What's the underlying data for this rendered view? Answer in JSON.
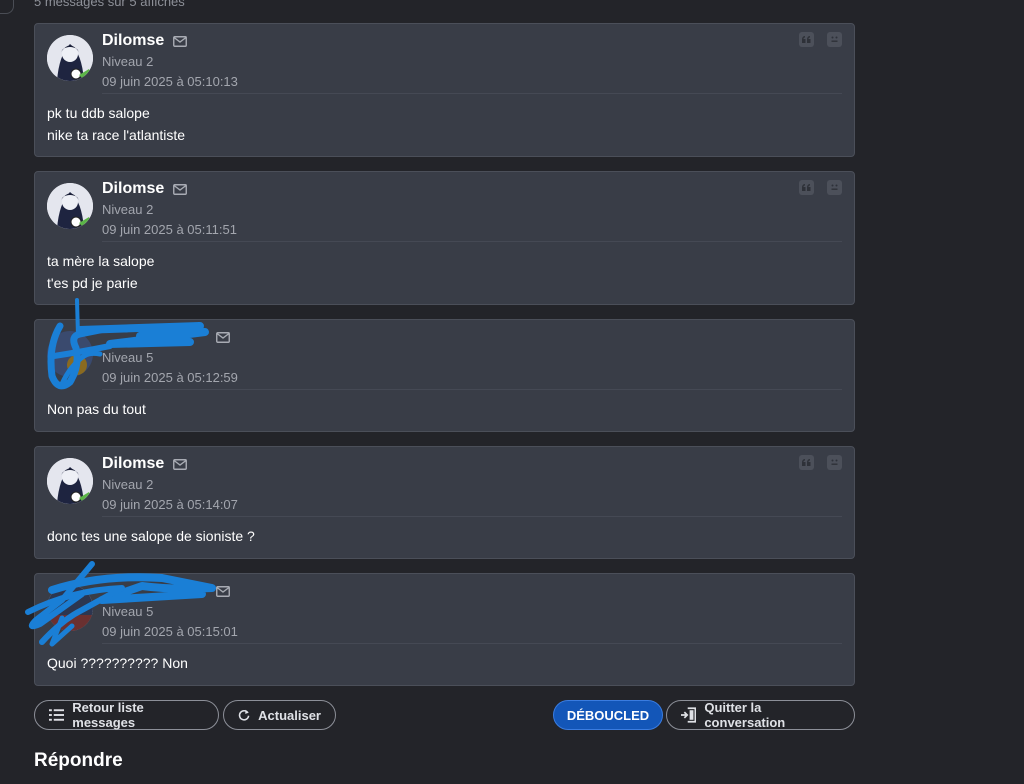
{
  "header": {
    "count_text": "5 messages sur 5 affichés"
  },
  "messages": [
    {
      "author": "Dilomse",
      "level": "Niveau 2",
      "date": "09 juin 2025 à 05:10:13",
      "lines": [
        "pk tu ddb salope",
        "nike ta race l'atlantiste"
      ]
    },
    {
      "author": "Dilomse",
      "level": "Niveau 2",
      "date": "09 juin 2025 à 05:11:51",
      "lines": [
        "ta mère la salope",
        "t'es pd je parie"
      ]
    },
    {
      "author": "",
      "level": "Niveau 5",
      "date": "09 juin 2025 à 05:12:59",
      "lines": [
        "Non pas du tout"
      ]
    },
    {
      "author": "Dilomse",
      "level": "Niveau 2",
      "date": "09 juin 2025 à 05:14:07",
      "lines": [
        "donc tes une salope de sioniste ?"
      ]
    },
    {
      "author": "",
      "level": "Niveau 5",
      "date": "09 juin 2025 à 05:15:01",
      "lines": [
        "Quoi ?????????? Non"
      ]
    }
  ],
  "buttons": {
    "back_label": "Retour liste messages",
    "refresh_label": "Actualiser",
    "primary_label": "DÉBOUCLED",
    "quit_label": "Quitter la conversation"
  },
  "reply": {
    "title": "Répondre"
  },
  "icons": {
    "mail": "mail-icon",
    "quote": "quote-icon",
    "report": "report-icon",
    "list": "list-icon",
    "refresh": "refresh-icon",
    "exit": "exit-door-icon"
  },
  "colors": {
    "background": "#232429",
    "card": "#393d47",
    "primary": "#1356b8",
    "scribble": "#1a7fd6"
  }
}
